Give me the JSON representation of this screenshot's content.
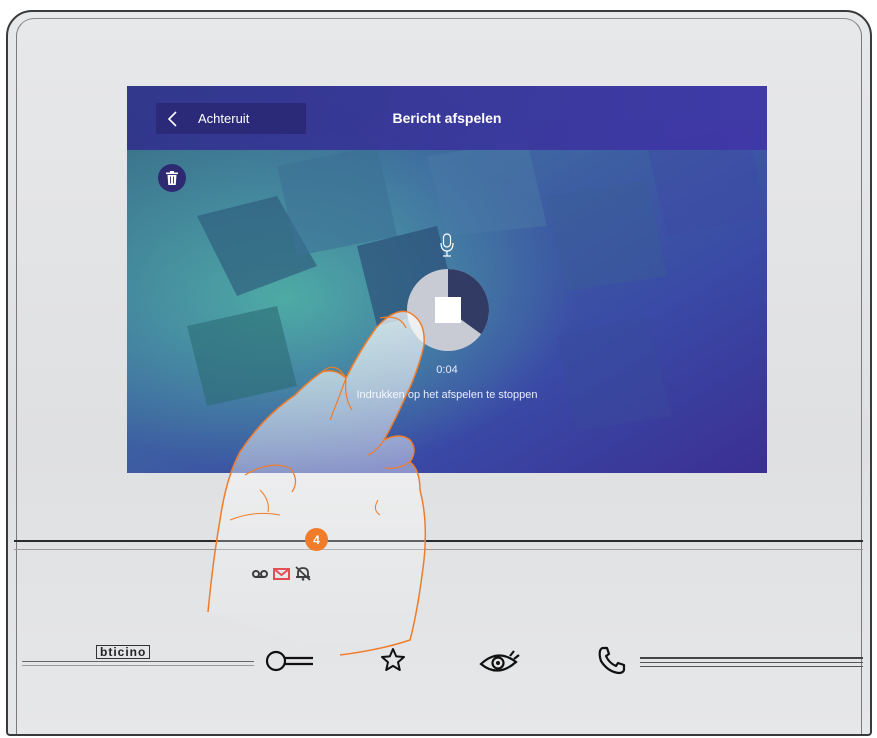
{
  "header": {
    "back_label": "Achteruit",
    "title": "Bericht afspelen"
  },
  "playback": {
    "elapsed": "0:04",
    "hint": "Indrukken op het afspelen te stoppen",
    "progress_fraction": 0.35
  },
  "device": {
    "brand": "bticino",
    "callout_number": "4"
  },
  "icons": {
    "back": "chevron-left-icon",
    "delete": "trash-icon",
    "microphone": "microphone-icon",
    "stop": "stop-icon",
    "voicemail": "voicemail-icon",
    "message": "envelope-icon",
    "mute": "bell-off-icon",
    "door": "key-icon",
    "favourite": "star-icon",
    "camera": "eye-icon",
    "call": "phone-icon"
  },
  "colors": {
    "accent_orange": "#f07c2a",
    "message_red": "#e0242c",
    "header_blue": "#3a3296"
  }
}
